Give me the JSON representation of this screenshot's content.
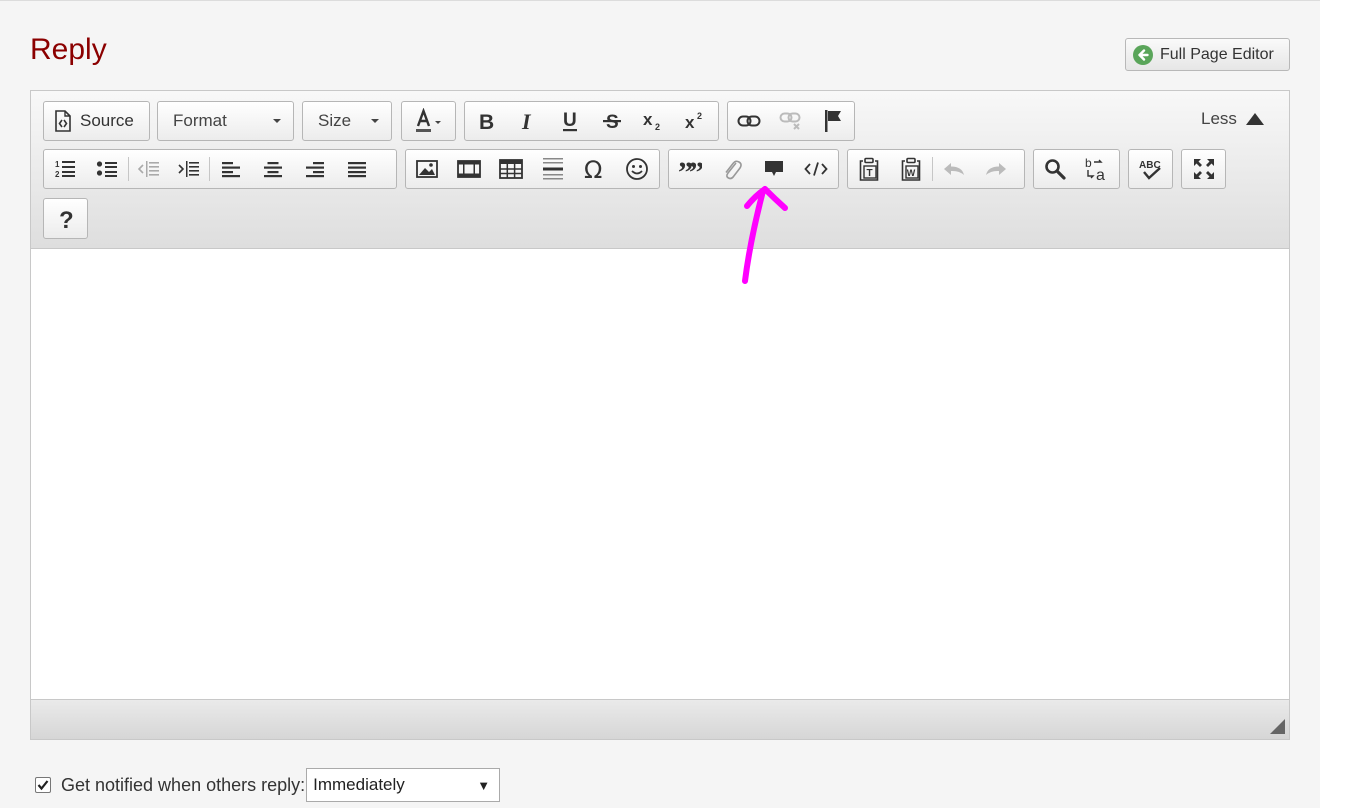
{
  "header": {
    "title": "Reply",
    "full_page_editor_label": "Full Page Editor",
    "full_page_editor_icon": "arrow-left-circle-icon"
  },
  "toolbar": {
    "source_label": "Source",
    "format_label": "Format",
    "size_label": "Size",
    "less_label": "Less",
    "row1": {
      "color": [
        "text-color-icon"
      ],
      "basic_styles": [
        "bold-icon",
        "italic-icon",
        "underline-icon",
        "strikethrough-icon",
        "subscript-icon",
        "superscript-icon"
      ],
      "links": [
        "link-icon",
        "unlink-icon",
        "anchor-icon"
      ]
    },
    "row2": {
      "lists": [
        "numbered-list-icon",
        "bulleted-list-icon",
        "decrease-indent-icon",
        "increase-indent-icon"
      ],
      "alignment": [
        "align-left-icon",
        "align-center-icon",
        "align-right-icon",
        "justify-icon"
      ],
      "insert": [
        "image-icon",
        "video-icon",
        "table-icon",
        "horizontal-line-icon",
        "special-character-icon",
        "emoji-icon"
      ],
      "blocks": [
        "blockquote-icon",
        "attachment-icon",
        "comment-icon",
        "code-icon"
      ],
      "clipboard": [
        "paste-text-icon",
        "paste-word-icon",
        "undo-icon",
        "redo-icon"
      ],
      "find": [
        "find-icon",
        "replace-icon"
      ],
      "spellcheck": [
        "spellcheck-icon"
      ],
      "maximize": [
        "maximize-icon"
      ]
    },
    "row3": {
      "help": [
        "help-icon"
      ]
    }
  },
  "annotation": {
    "color": "#ff00ff",
    "points_to": "comment-icon"
  },
  "notify": {
    "label": "Get notified when others reply:",
    "checked": true,
    "frequency_value": "Immediately"
  },
  "colors": {
    "title": "#8b0000",
    "fpe_icon": "#5aa55a"
  }
}
